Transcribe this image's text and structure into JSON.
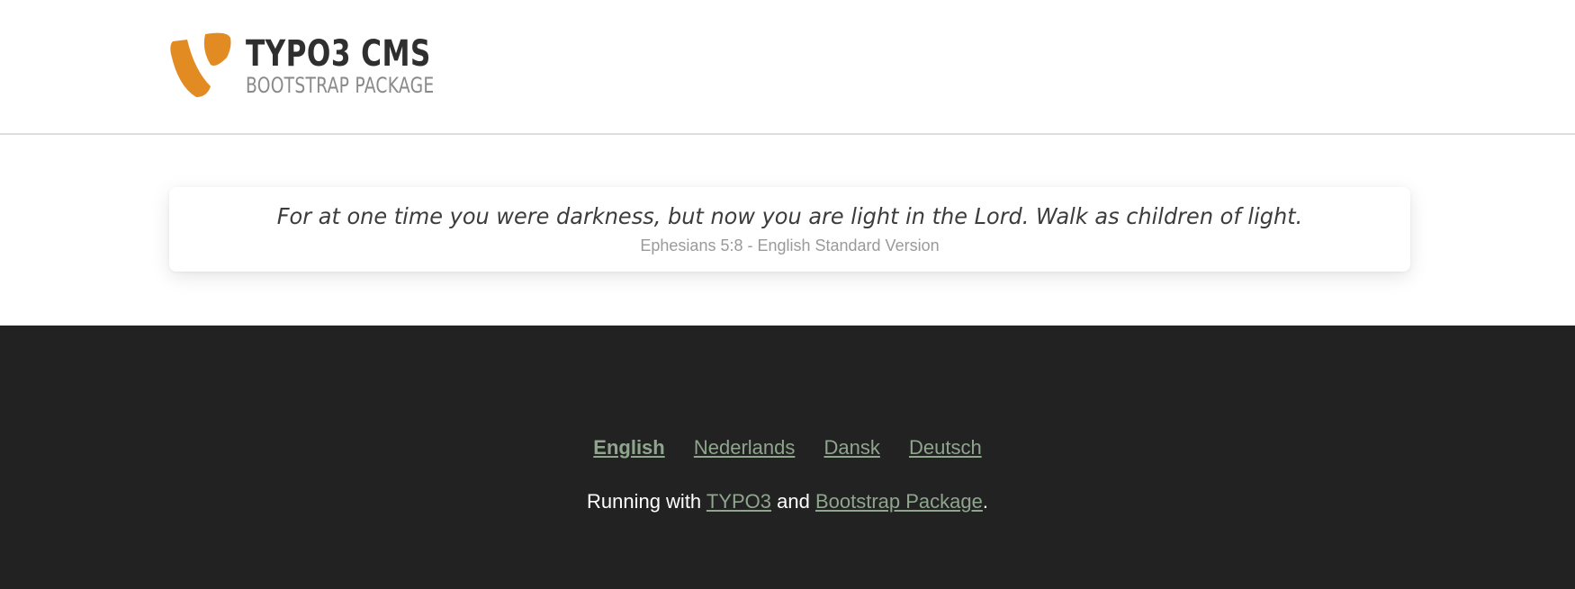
{
  "header": {
    "logo_title": "TYPO3 CMS",
    "logo_subtitle": "BOOTSTRAP PACKAGE",
    "logo_color": "#e38b23"
  },
  "quote": {
    "text": "For at one time you were darkness, but now you are light in the Lord. Walk as children of light.",
    "source": "Ephesians 5:8 - English Standard Version"
  },
  "footer": {
    "languages": [
      {
        "label": "English",
        "active": true
      },
      {
        "label": "Nederlands",
        "active": false
      },
      {
        "label": "Dansk",
        "active": false
      },
      {
        "label": "Deutsch",
        "active": false
      }
    ],
    "credits_prefix": "Running with ",
    "credits_link1": "TYPO3",
    "credits_middle": " and ",
    "credits_link2": "Bootstrap Package",
    "credits_suffix": ".",
    "background": "#222222",
    "link_color": "#8fa58d"
  }
}
